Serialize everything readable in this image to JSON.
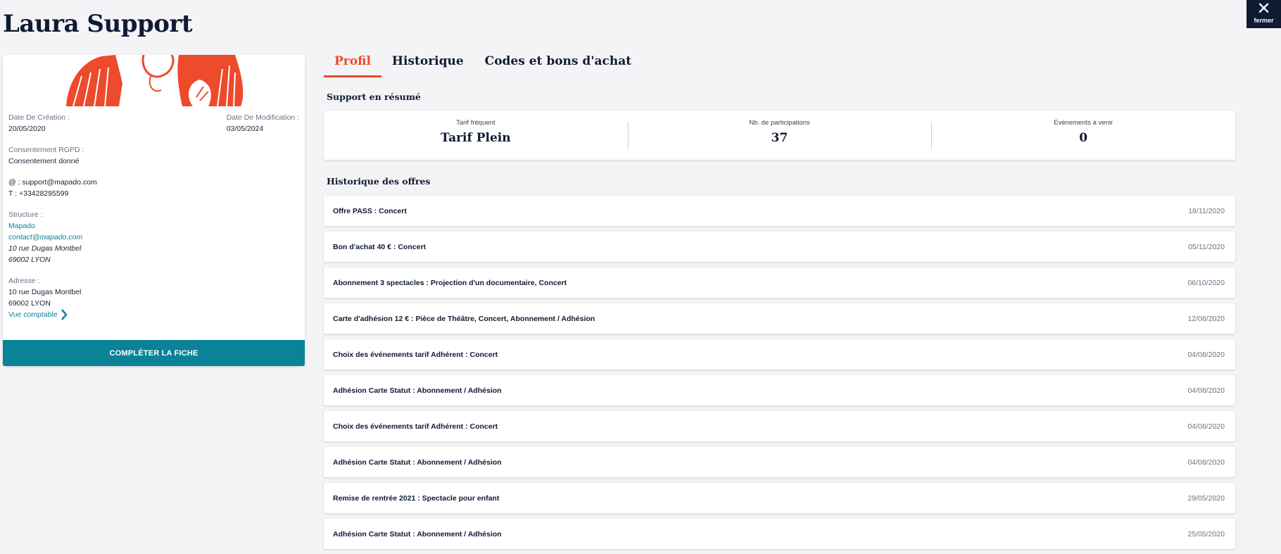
{
  "page": {
    "title": "Laura Support"
  },
  "close": {
    "label": "fermer"
  },
  "profile": {
    "created_label": "Date De Création :",
    "created_value": "20/05/2020",
    "modified_label": "Date De Modification :",
    "modified_value": "03/05/2024",
    "gdpr_label": "Consentement RGPD :",
    "gdpr_value": "Consentement donné",
    "email_line": "@ : support@mapado.com",
    "phone_line": "T : +33428295599",
    "structure_label": "Structure :",
    "structure_name": "Mapado",
    "structure_email": "contact@mapado.com",
    "structure_street": "10 rue Dugas Montbel",
    "structure_city": "69002 LYON",
    "address_label": "Adresse :",
    "address_street": "10 rue Dugas Montbel",
    "address_city": "69002 LYON",
    "accounting_link": "Vue comptable",
    "complete_button": "COMPLÉTER LA FICHE"
  },
  "tabs": [
    {
      "label": "Profil",
      "active": true
    },
    {
      "label": "Historique",
      "active": false
    },
    {
      "label": "Codes et bons d'achat",
      "active": false
    }
  ],
  "summary": {
    "title": "Support en résumé",
    "stats": [
      {
        "label": "Tarif fréquent",
        "value": "Tarif Plein"
      },
      {
        "label": "Nb. de participations",
        "value": "37"
      },
      {
        "label": "Evénements à venir",
        "value": "0"
      }
    ]
  },
  "offers": {
    "title": "Historique des offres",
    "items": [
      {
        "name": "Offre PASS : Concert",
        "date": "18/11/2020"
      },
      {
        "name": "Bon d'achat 40 € : Concert",
        "date": "05/11/2020"
      },
      {
        "name": "Abonnement 3 spectacles : Projection d'un documentaire, Concert",
        "date": "06/10/2020"
      },
      {
        "name": "Carte d'adhésion 12 € : Pièce de Théâtre, Concert, Abonnement / Adhésion",
        "date": "12/08/2020"
      },
      {
        "name": "Choix des événements tarif Adhérent : Concert",
        "date": "04/08/2020"
      },
      {
        "name": "Adhésion Carte Statut : Abonnement / Adhésion",
        "date": "04/08/2020"
      },
      {
        "name": "Choix des événements tarif Adhérent : Concert",
        "date": "04/08/2020"
      },
      {
        "name": "Adhésion Carte Statut : Abonnement / Adhésion",
        "date": "04/08/2020"
      },
      {
        "name": "Remise de rentrée 2021 : Spectacle pour enfant",
        "date": "29/05/2020"
      },
      {
        "name": "Adhésion Carte Statut : Abonnement / Adhésion",
        "date": "25/05/2020"
      }
    ]
  },
  "colors": {
    "accent": "#ee4a2c",
    "teal": "#0a8398",
    "navy": "#0e1b33"
  }
}
